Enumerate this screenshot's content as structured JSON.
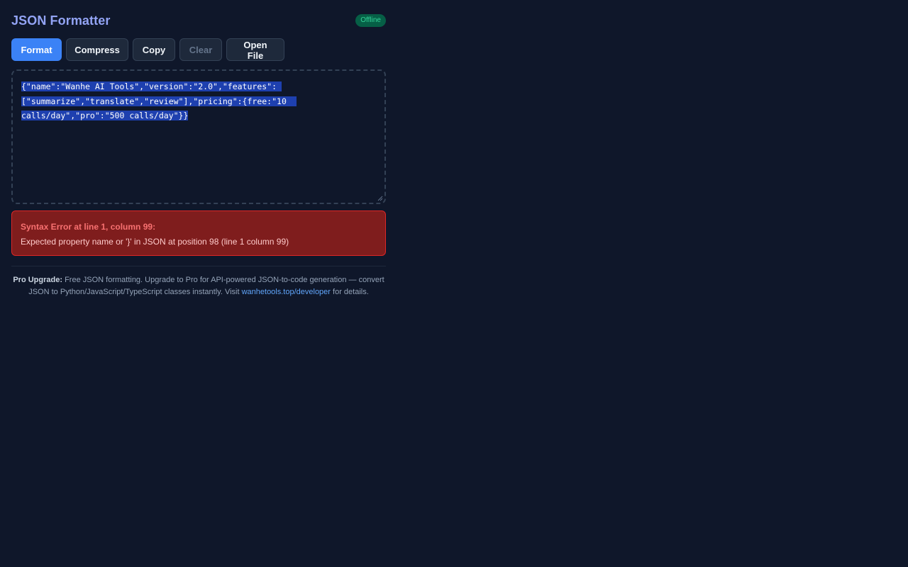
{
  "header": {
    "title": "JSON Formatter",
    "status_badge": "Offline",
    "status_color": "#34d399"
  },
  "toolbar": {
    "format_label": "Format",
    "compress_label": "Compress",
    "copy_label": "Copy",
    "clear_label": "Clear",
    "open_file_label": "Open File",
    "accent_color": "#3b82f6"
  },
  "editor": {
    "value": "{\"name\":\"Wanhe AI Tools\",\"version\":\"2.0\",\"features\":[\"summarize\",\"translate\",\"review\"],\"pricing\":{free:\"10 calls/day\",\"pro\":\"500 calls/day\"}}",
    "lines": [
      "{\"name\":\"Wanhe AI Tools\",\"version\":\"2.0\",\"features\": ",
      "[\"summarize\",\"translate\",\"review\"],\"pricing\":{free:\"10  ",
      "calls/day\",\"pro\":\"500 calls/day\"}}"
    ],
    "resize_icon": "resize-grip-icon"
  },
  "error": {
    "title": "Syntax Error at line 1, column 99:",
    "message": "Expected property name or '}' in JSON at position 98 (line 1 column 99)",
    "color": "#f87171"
  },
  "footer": {
    "label": "Pro Upgrade:",
    "text_before_link": " Free JSON formatting. Upgrade to Pro for API-powered JSON-to-code generation — convert JSON to Python/JavaScript/TypeScript classes instantly. Visit ",
    "link_text": "wanhetools.top/developer",
    "text_after_link": " for details."
  }
}
